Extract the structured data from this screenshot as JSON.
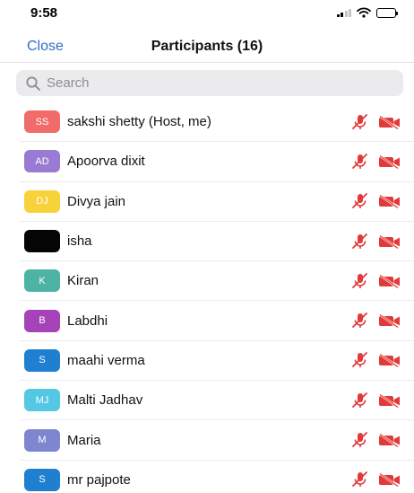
{
  "status_bar": {
    "time": "9:58"
  },
  "nav": {
    "close_label": "Close",
    "title": "Participants (16)"
  },
  "search": {
    "placeholder": "Search",
    "value": ""
  },
  "colors": {
    "accent": "#2d6fc4",
    "muted_red": "#e23a3a"
  },
  "participants": [
    {
      "initials": "SS",
      "name": "sakshi shetty (Host, me)",
      "avatar_color": "#f26b6b",
      "mic_icon": "mic-muted-icon",
      "video_icon": "video-off-icon"
    },
    {
      "initials": "AD",
      "name": "Apoorva dixit",
      "avatar_color": "#9a7bd4",
      "mic_icon": "mic-muted-icon",
      "video_icon": "video-off-icon"
    },
    {
      "initials": "DJ",
      "name": "Divya jain",
      "avatar_color": "#f8d23a",
      "mic_icon": "mic-muted-icon",
      "video_icon": "video-off-icon"
    },
    {
      "initials": "",
      "name": "isha",
      "avatar_color": "#050505",
      "mic_icon": "mic-muted-icon",
      "video_icon": "video-off-icon"
    },
    {
      "initials": "K",
      "name": "Kiran",
      "avatar_color": "#4db3a4",
      "mic_icon": "mic-muted-icon",
      "video_icon": "video-off-icon"
    },
    {
      "initials": "B",
      "name": "Labdhi",
      "avatar_color": "#a643b8",
      "mic_icon": "mic-muted-icon",
      "video_icon": "video-off-icon"
    },
    {
      "initials": "S",
      "name": "maahi verma",
      "avatar_color": "#1f7fd0",
      "mic_icon": "mic-muted-icon",
      "video_icon": "video-off-icon"
    },
    {
      "initials": "MJ",
      "name": "Malti Jadhav",
      "avatar_color": "#53c7e4",
      "mic_icon": "mic-muted-icon",
      "video_icon": "video-off-icon"
    },
    {
      "initials": "M",
      "name": "Maria",
      "avatar_color": "#7d86cf",
      "mic_icon": "mic-muted-icon",
      "video_icon": "video-off-icon"
    },
    {
      "initials": "S",
      "name": "mr pajpote",
      "avatar_color": "#1f7fd0",
      "mic_icon": "mic-muted-icon",
      "video_icon": "video-off-icon"
    }
  ]
}
